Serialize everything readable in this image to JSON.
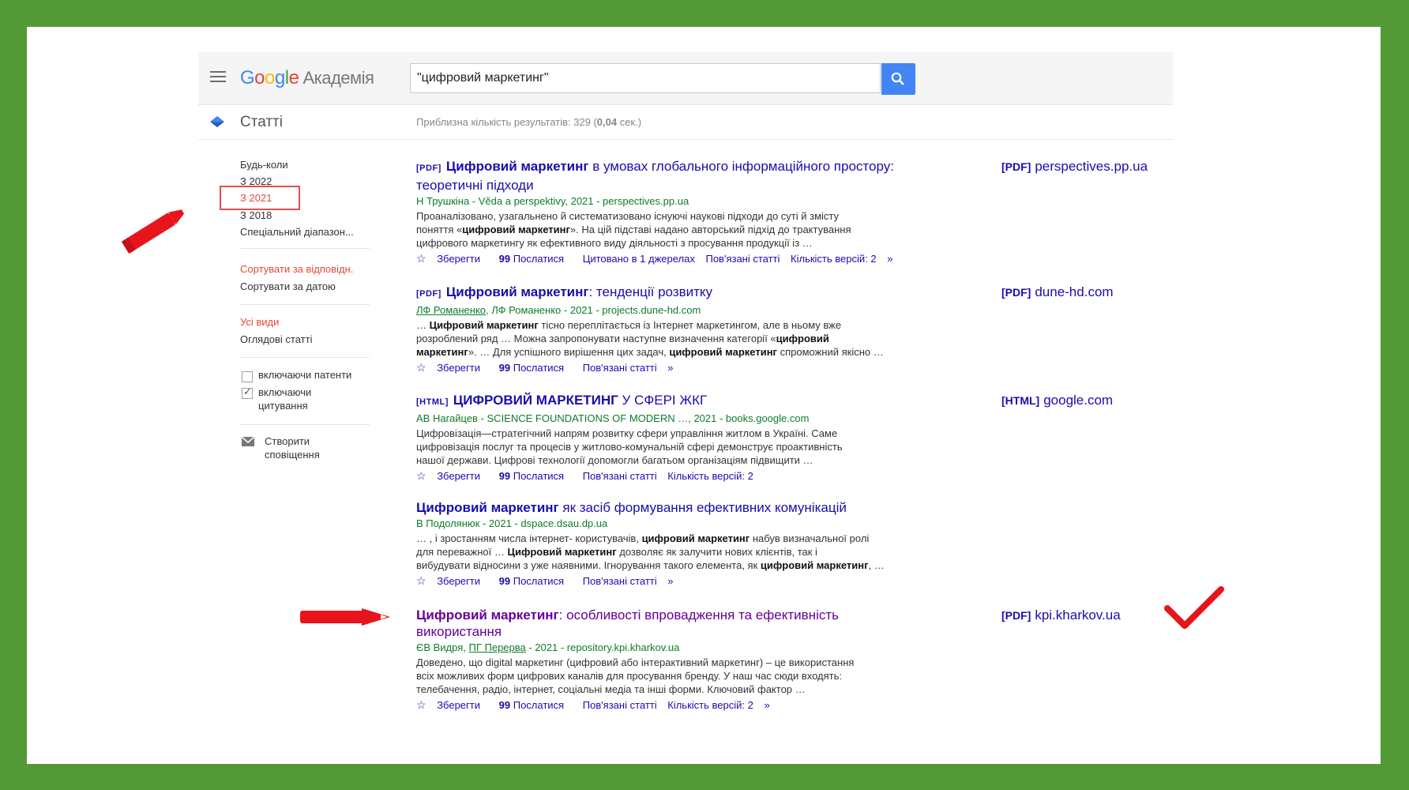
{
  "header": {
    "logo_google": "Google",
    "logo_product": "Академія",
    "search_value": "\"цифровий маркетинг\""
  },
  "subheader": {
    "section_label": "Статті",
    "result_count": "Приблизна кількість результатів: 329 (",
    "result_time": "0,04",
    "result_time_suffix": " сек.)"
  },
  "sidebar": {
    "time_any": "Будь-коли",
    "time_2022": "З 2022",
    "time_2021": "З 2021",
    "time_2018": "З 2018",
    "time_custom": "Спеціальний діапазон...",
    "sort_relevance": "Сортувати за відповідн.",
    "sort_date": "Сортувати за датою",
    "type_all": "Усі види",
    "type_review": "Оглядові статті",
    "include_patents": "включаючи патенти",
    "include_citations_1": "включаючи",
    "include_citations_2": "цитування",
    "create_alert_1": "Створити",
    "create_alert_2": "сповіщення"
  },
  "results": [
    {
      "tag": "[PDF]",
      "title_bold": "Цифровий маркетинг",
      "title_rest": " в умовах глобального інформаційного простору:",
      "title_line2": "теоретичні підходи",
      "meta": "Н Трушкіна - Věda a perspektivy, 2021 - perspectives.pp.ua",
      "snippet_1": "Проаналізовано, узагальнено й систематизовано існуючі наукові підходи до суті й змісту",
      "snippet_2a": "поняття «",
      "snippet_2b": "цифровий маркетинг",
      "snippet_2c": "». На цій підставі надано авторський підхід до трактування",
      "snippet_3": "цифрового маркетингу як ефективного виду діяльності з просування продукції із …",
      "save": "Зберегти",
      "cite": "Послатися",
      "cited_by": "Цитовано в 1 джерелах",
      "related": "Пов'язані статті",
      "versions": "Кількість версій: 2",
      "side_tag": "[PDF]",
      "side_domain": "perspectives.pp.ua"
    },
    {
      "tag": "[PDF]",
      "title_bold": "Цифровий маркетинг",
      "title_rest": ": тенденції розвитку",
      "meta_author": "ЛФ Романенко",
      "meta_rest": ", ЛФ Романенко - 2021 - projects.dune-hd.com",
      "snippet_1a": "… ",
      "snippet_1b": "Цифровий маркетинг",
      "snippet_1c": " тісно переплітається із Інтернет маркетингом, але в ньому вже",
      "snippet_2a": "розроблений ряд … Можна запропонувати наступне визначення категорії «",
      "snippet_2b": "цифровий",
      "snippet_3a": "маркетинг",
      "snippet_3b": "». … Для успішного вирішення цих задач, ",
      "snippet_3c": "цифровий маркетинг",
      "snippet_3d": " спроможний якісно …",
      "save": "Зберегти",
      "cite": "Послатися",
      "related": "Пов'язані статті",
      "side_tag": "[PDF]",
      "side_domain": "dune-hd.com"
    },
    {
      "tag": "[HTML]",
      "title_bold": "ЦИФРОВИЙ МАРКЕТИНГ",
      "title_rest": " У СФЕРІ ЖКГ",
      "meta": "АВ Нагайцев - SCIENCE FOUNDATIONS OF MODERN …, 2021 - books.google.com",
      "snippet_1": "Цифровізація—стратегічний напрям розвитку сфери управління житлом в Україні. Саме",
      "snippet_2": "цифровізація послуг та процесів у житлово-комунальній сфері демонструє проактивність",
      "snippet_3": "нашої держави. Цифрові технології допомогли багатьом організаціям підвищити …",
      "save": "Зберегти",
      "cite": "Послатися",
      "related": "Пов'язані статті",
      "versions": "Кількість версій: 2",
      "side_tag": "[HTML]",
      "side_domain": "google.com"
    },
    {
      "title_bold": "Цифровий маркетинг",
      "title_rest": " як засіб формування ефективних комунікацій",
      "meta": "В Подолянюк - 2021 - dspace.dsau.dp.ua",
      "snippet_1a": "… , і зростанням числа інтернет- користувачів, ",
      "snippet_1b": "цифровий маркетинг",
      "snippet_1c": " набув визначальної ролі",
      "snippet_2a": "для переважної … ",
      "snippet_2b": "Цифровий маркетинг",
      "snippet_2c": " дозволяє як залучити нових клієнтів, так і",
      "snippet_3a": "вибудувати відносини з уже наявними. Ігнорування такого елемента, як ",
      "snippet_3b": "цифровий маркетинг",
      "snippet_3c": ", …",
      "save": "Зберегти",
      "cite": "Послатися",
      "related": "Пов'язані статті"
    },
    {
      "title_bold": "Цифровий маркетинг",
      "title_rest": ": особливості впровадження та ефективність",
      "title_line2": "використання",
      "meta_a": "ЄВ Видря, ",
      "meta_author": "ПГ Перерва",
      "meta_rest": " - 2021 - repository.kpi.kharkov.ua",
      "snippet_1": "Доведено, що digital маркетинг (цифровий або інтерактивний маркетинг) – це використання",
      "snippet_2": "всіх можливих форм цифрових каналів для просування бренду. У наш час сюди входять:",
      "snippet_3": "телебачення, радіо, інтернет, соціальні медіа та інші форми. Ключовий фактор …",
      "save": "Зберегти",
      "cite": "Послатися",
      "related": "Пов'язані статті",
      "versions": "Кількість версій: 2",
      "side_tag": "[PDF]",
      "side_domain": "kpi.kharkov.ua"
    }
  ],
  "icons": {
    "menu": "hamburger-icon",
    "search": "magnifier-icon",
    "articles": "scholar-cap-icon",
    "star": "star-icon",
    "quote": "quote-icon",
    "more": "double-chevron-icon",
    "mail": "envelope-icon",
    "pencil": "pencil-annotation",
    "arrow": "arrow-annotation",
    "check": "checkmark-annotation"
  },
  "colors": {
    "frame": "#539a36",
    "link": "#1a0dab",
    "visited": "#660099",
    "meta_green": "#0e7c2a",
    "accent_red": "#dd4b39",
    "annotation_red": "#e8141c",
    "search_blue": "#4285f4"
  }
}
